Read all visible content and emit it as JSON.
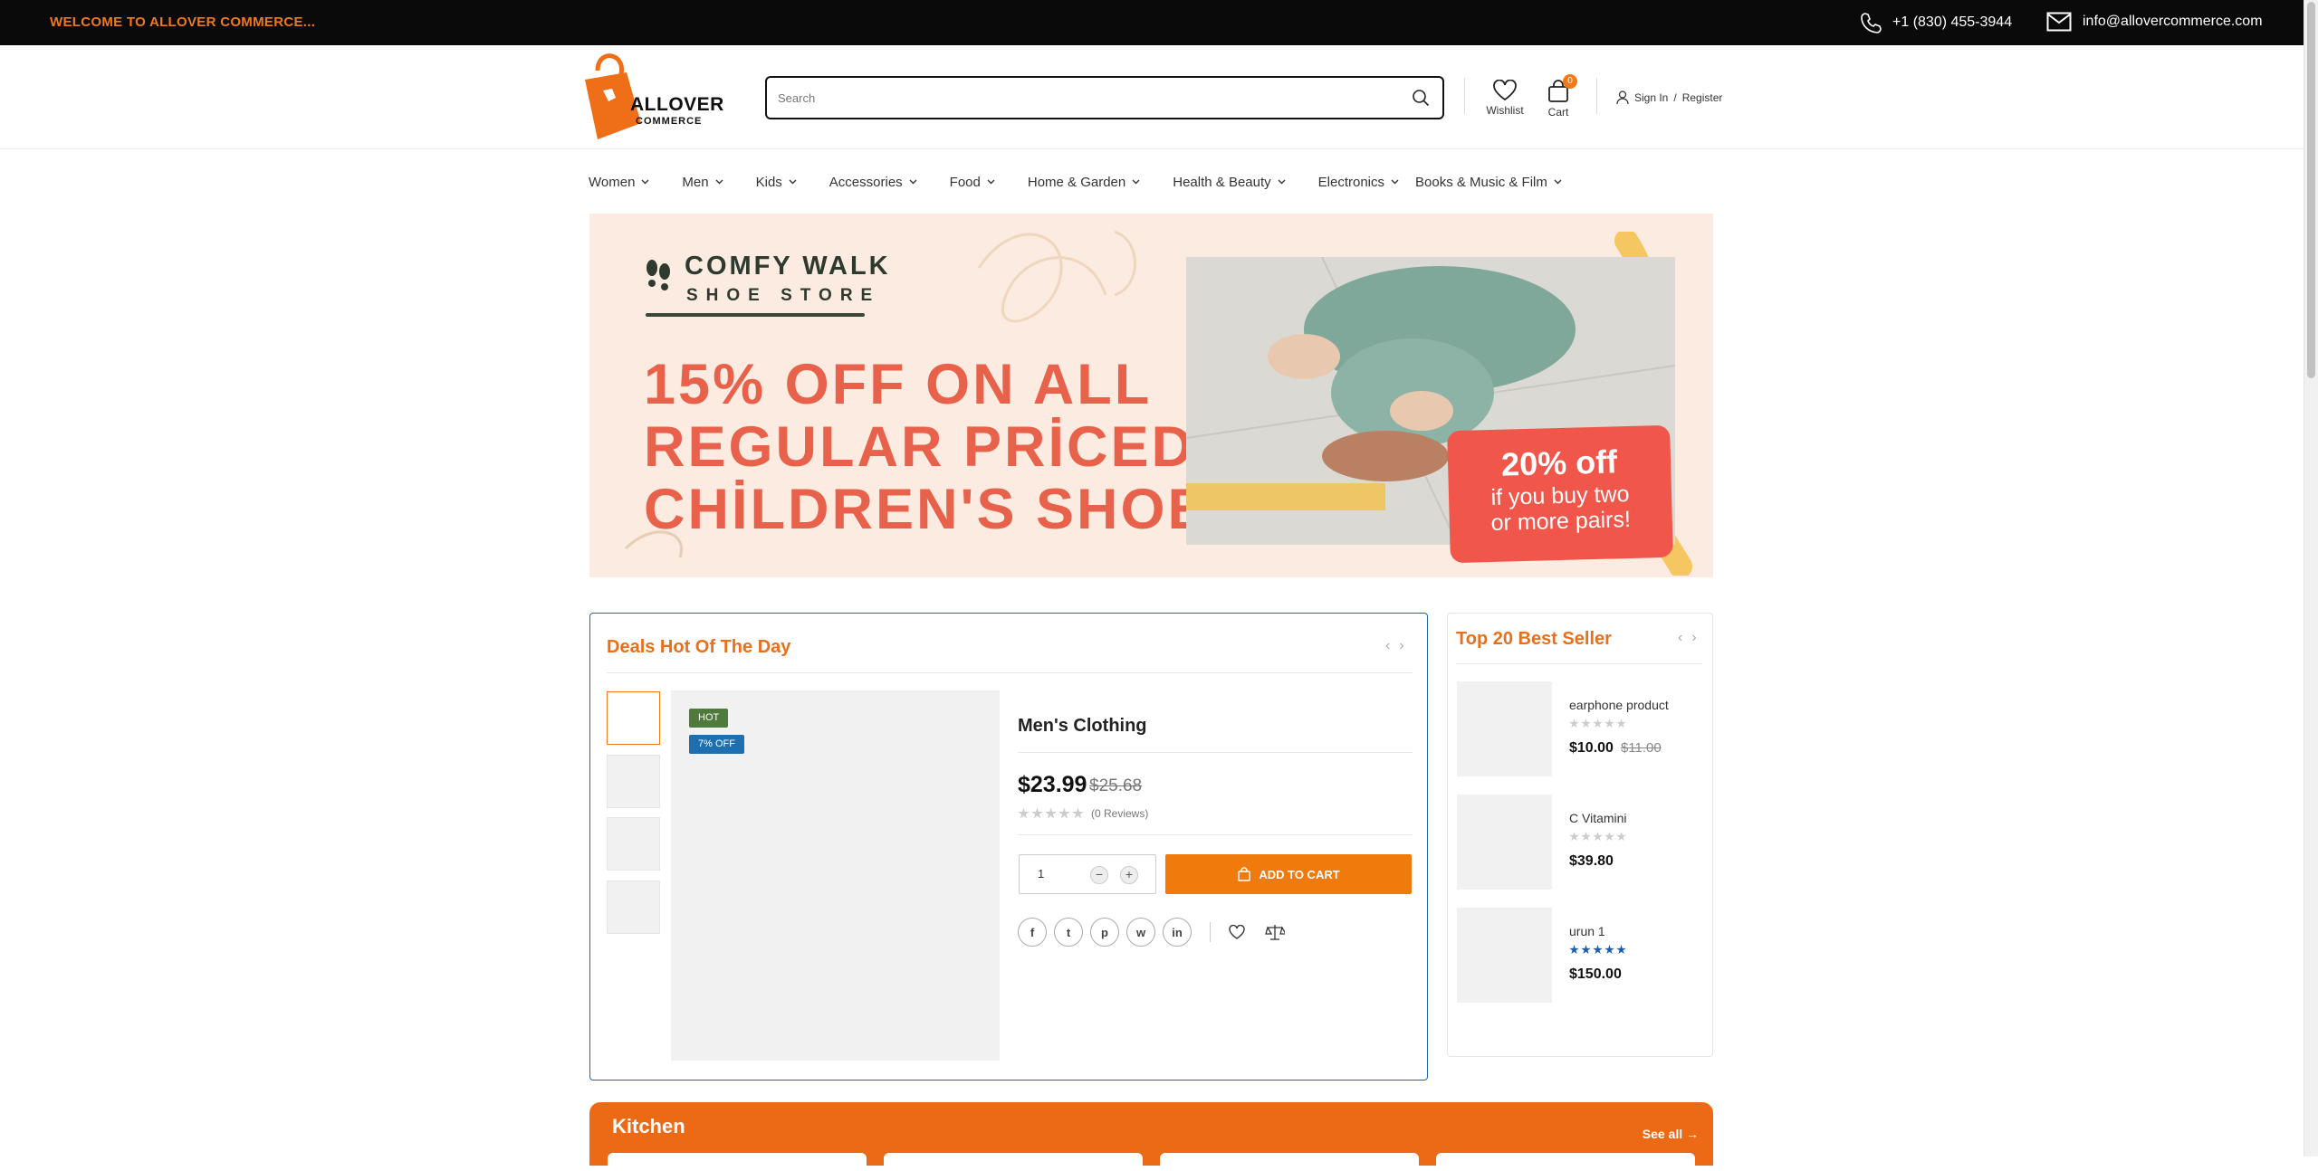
{
  "topbar": {
    "welcome": "WELCOME TO ALLOVER COMMERCE...",
    "phone": "+1 (830) 455-3944",
    "email": "info@allovercommerce.com"
  },
  "header": {
    "logo_line1": "ALLOVER",
    "logo_line2": "COMMERCE",
    "search_placeholder": "Search",
    "wishlist_label": "Wishlist",
    "cart_label": "Cart",
    "cart_count": "0",
    "signin_label": "Sign In",
    "register_label": "Register"
  },
  "nav": {
    "items": [
      "Women",
      "Men",
      "Kids",
      "Accessories",
      "Food",
      "Home & Garden",
      "Health & Beauty",
      "Electronics",
      "Books & Music & Film"
    ]
  },
  "banner": {
    "brand_line1": "COMFY WALK",
    "brand_line2": "SHOE STORE",
    "promo_line1": "15% OFF ON ALL",
    "promo_line2": "REGULAR PRİCED",
    "promo_line3": "CHİLDREN'S SHOES",
    "offer_title": "20% off",
    "offer_line1": "if you buy two",
    "offer_line2": "or more pairs!"
  },
  "deals": {
    "title": "Deals Hot Of The Day",
    "tag_hot": "HOT",
    "tag_off": "7% OFF",
    "product_name": "Men's Clothing",
    "price": "$23.99",
    "old_price": "$25.68",
    "reviews": "(0 Reviews)",
    "quantity": "1",
    "add_to_cart": "ADD TO CART"
  },
  "bestsellers": {
    "title": "Top 20 Best Seller",
    "items": [
      {
        "name": "earphone product",
        "price": "$10.00",
        "old_price": "$11.00",
        "rating": 0
      },
      {
        "name": "C Vitamini",
        "price": "$39.80",
        "old_price": "",
        "rating": 0
      },
      {
        "name": "urun 1",
        "price": "$150.00",
        "old_price": "",
        "rating": 5
      }
    ]
  },
  "kitchen": {
    "title": "Kitchen",
    "see_all": "See all →"
  },
  "colors": {
    "accent": "#f07a1a",
    "topbar": "#0a0a0a",
    "deals_border": "#2266a8",
    "hot_tag": "#4e7a3c",
    "off_tag": "#1e6fb0"
  }
}
